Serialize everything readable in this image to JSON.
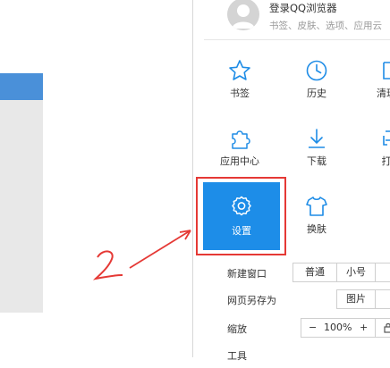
{
  "login": {
    "title": "登录QQ浏览器",
    "subtitle": "书签、皮肤、选项、应用云"
  },
  "grid": [
    {
      "label": "书签",
      "icon": "star-icon"
    },
    {
      "label": "历史",
      "icon": "clock-icon"
    },
    {
      "label": "清理",
      "icon": "clean-icon"
    },
    {
      "label": "应用中心",
      "icon": "puzzle-icon"
    },
    {
      "label": "下载",
      "icon": "download-icon"
    },
    {
      "label": "打",
      "icon": "print-icon"
    },
    {
      "label": "设置",
      "icon": "gear-icon"
    },
    {
      "label": "换肤",
      "icon": "tshirt-icon"
    }
  ],
  "rows": {
    "new_window": {
      "label": "新建窗口",
      "option1": "普通",
      "option2": "小号"
    },
    "save_page": {
      "label": "网页另存为",
      "option1": "图片"
    },
    "zoom": {
      "label": "缩放",
      "minus": "−",
      "value": "100%",
      "plus": "+"
    },
    "tools": {
      "label": "工具"
    }
  },
  "annotation": {
    "number": "2"
  },
  "colors": {
    "accent": "#1d8de8",
    "highlight": "#e53935",
    "icon": "#1e8ce6"
  }
}
